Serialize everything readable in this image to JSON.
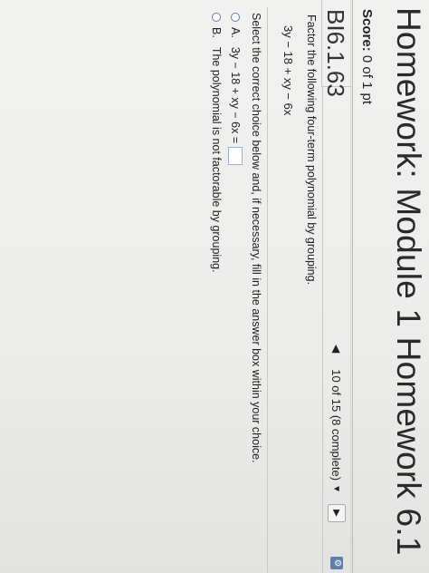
{
  "header": {
    "title": "Homework: Module 1 Homework 6.1",
    "score_label": "Score:",
    "score_value": "0 of 1 pt"
  },
  "question": {
    "id": "BI6.1.63",
    "progress": "10 of 15 (8 complete)",
    "prompt": "Factor the following four-term polynomial by grouping.",
    "polynomial": "3y − 18 + xy − 6x",
    "instructions": "Select the correct choice below and, if necessary, fill in the answer box within your choice.",
    "choices": [
      {
        "letter": "A.",
        "text": "3y − 18 + xy − 6x =",
        "answer_value": ""
      },
      {
        "letter": "B.",
        "text": "The polynomial is not factorable by grouping."
      }
    ]
  },
  "icons": {
    "prev": "triangle-left-icon",
    "dropdown": "caret-down-icon",
    "next": "triangle-right-icon",
    "settings": "settings-icon"
  },
  "colors": {
    "accent": "#5e7fb2",
    "answer_box_border": "#98b4d8"
  }
}
